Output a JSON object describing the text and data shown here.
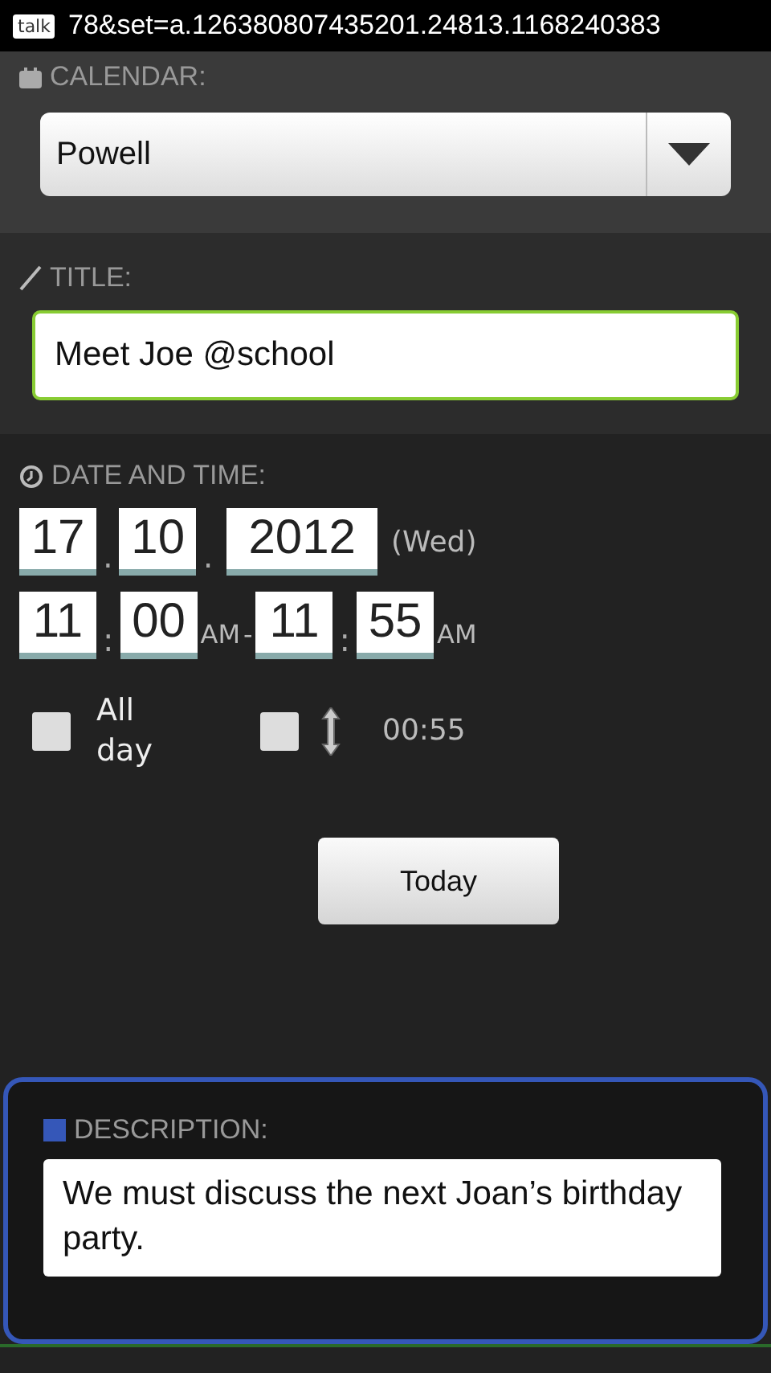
{
  "status_bar": {
    "app_badge": "talk",
    "ticker": "78&set=a.126380807435201.24813.1168240383"
  },
  "calendar": {
    "label": "CALENDAR:",
    "value": "Powell"
  },
  "title": {
    "label": "TITLE:",
    "value": "Meet Joe @school"
  },
  "date_time": {
    "label": "DATE AND TIME:",
    "date": [
      "17",
      "10",
      "2012"
    ],
    "date_sep": ".",
    "weekday": "(Wed)",
    "start": [
      "11",
      "00"
    ],
    "start_ampm": "AM",
    "dash": "-",
    "end": [
      "11",
      "55"
    ],
    "end_ampm": "AM",
    "time_sep": ":",
    "all_day": {
      "label": "All day",
      "checked": false
    },
    "duration": {
      "checked": false,
      "value": "00:55"
    },
    "today_button": "Today"
  },
  "description": {
    "label": "DESCRIPTION:",
    "value": "We must discuss the next Joan’s birthday party."
  }
}
